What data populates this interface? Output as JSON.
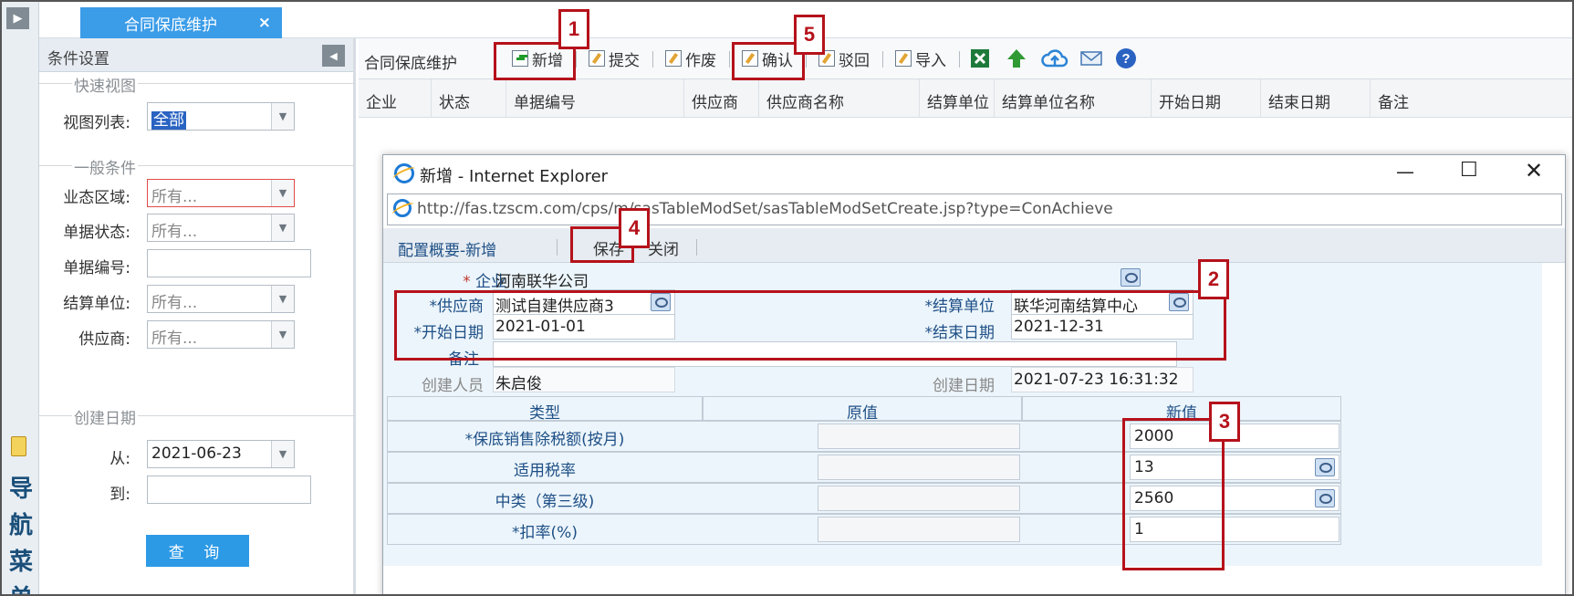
{
  "nav": {
    "label": "导航菜单",
    "chars": [
      "导",
      "航",
      "菜",
      "单"
    ]
  },
  "tab": {
    "title": "合同保底维护",
    "close": "×"
  },
  "conditions": {
    "header": "条件设置",
    "quick_view": {
      "title": "快速视图",
      "view_list_label": "视图列表:",
      "view_list_value": "全部"
    },
    "general": {
      "title": "一般条件",
      "fields": [
        {
          "label": "业态区域:",
          "placeholder": "所有..."
        },
        {
          "label": "单据状态:",
          "placeholder": "所有..."
        },
        {
          "label": "单据编号:",
          "value": ""
        },
        {
          "label": "结算单位:",
          "placeholder": "所有..."
        },
        {
          "label": "供应商:",
          "placeholder": "所有..."
        }
      ]
    },
    "created": {
      "title": "创建日期",
      "from_label": "从:",
      "from_value": "2021-06-23",
      "to_label": "到:",
      "to_value": ""
    },
    "query_button": "查 询"
  },
  "toolbar": {
    "title": "合同保底维护",
    "add": "新增",
    "submit": "提交",
    "void": "作废",
    "confirm": "确认",
    "reject": "驳回",
    "import": "导入"
  },
  "grid": {
    "columns": [
      "企业",
      "状态",
      "单据编号",
      "供应商",
      "供应商名称",
      "结算单位",
      "结算单位名称",
      "开始日期",
      "结束日期",
      "备注"
    ]
  },
  "dialog": {
    "title": "新增 - Internet Explorer",
    "url": "http://fas.tzscm.com/cps/m/sasTableModSet/sasTableModSetCreate.jsp?type=ConAchieve",
    "toolbar_title": "配置概要-新增",
    "save": "保存",
    "close": "关闭",
    "form": {
      "company_label": "企业",
      "company_value": "河南联华公司",
      "supplier_label": "*供应商",
      "supplier_value": "测试自建供应商3",
      "settle_label": "*结算单位",
      "settle_value": "联华河南结算中心",
      "start_label": "*开始日期",
      "start_value": "2021-01-01",
      "end_label": "*结束日期",
      "end_value": "2021-12-31",
      "remark_label": "备注",
      "remark_value": "",
      "creator_label": "创建人员",
      "creator_value": "朱启俊",
      "created_label": "创建日期",
      "created_value": "2021-07-23 16:31:32"
    },
    "subgrid": {
      "headers": [
        "类型",
        "原值",
        "新值"
      ],
      "rows": [
        {
          "type": "*保底销售除税额(按月)",
          "old": "",
          "new": "2000"
        },
        {
          "type": "适用税率",
          "old": "",
          "new": "13"
        },
        {
          "type": "中类（第三级)",
          "old": "",
          "new": "2560"
        },
        {
          "type": "*扣率(%)",
          "old": "",
          "new": "1"
        }
      ]
    }
  },
  "callouts": [
    "1",
    "2",
    "3",
    "4",
    "5"
  ],
  "colors": {
    "accent": "#3b9ce8",
    "callout": "#b5121b",
    "label_blue": "#1e4f86"
  }
}
